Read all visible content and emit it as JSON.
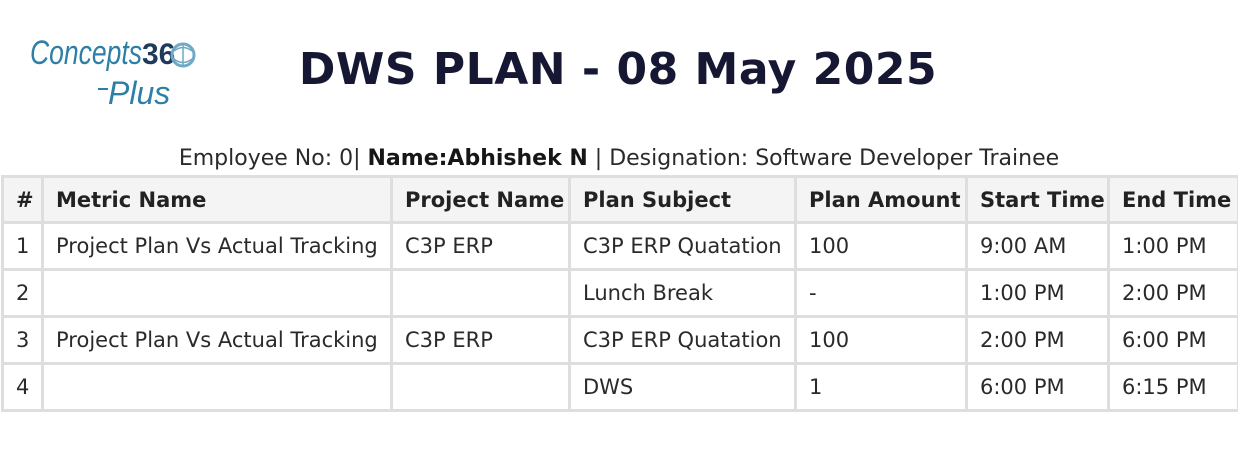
{
  "logo": {
    "line1": "Concepts360",
    "line2": "Plus",
    "colors": {
      "text": "#2e7fa6",
      "globe": "#6fa9c4"
    }
  },
  "page": {
    "title": "DWS PLAN - 08 May 2025"
  },
  "employee": {
    "number_label": "Employee No: 0|",
    "name_label": "Name:Abhishek N",
    "separator": "|",
    "designation_label": "Designation: Software Developer Trainee"
  },
  "table": {
    "headers": [
      "#",
      "Metric Name",
      "Project Name",
      "Plan Subject",
      "Plan Amount",
      "Start Time",
      "End Time"
    ],
    "rows": [
      [
        "1",
        "Project Plan Vs Actual Tracking",
        "C3P ERP",
        "C3P ERP Quatation",
        "100",
        "9:00 AM",
        "1:00 PM"
      ],
      [
        "2",
        "",
        "",
        "Lunch Break",
        "-",
        "1:00 PM",
        "2:00 PM"
      ],
      [
        "3",
        "Project Plan Vs Actual Tracking",
        "C3P ERP",
        "C3P ERP Quatation",
        "100",
        "2:00 PM",
        "6:00 PM"
      ],
      [
        "4",
        "",
        "",
        "DWS",
        "1",
        "6:00 PM",
        "6:15 PM"
      ]
    ]
  }
}
